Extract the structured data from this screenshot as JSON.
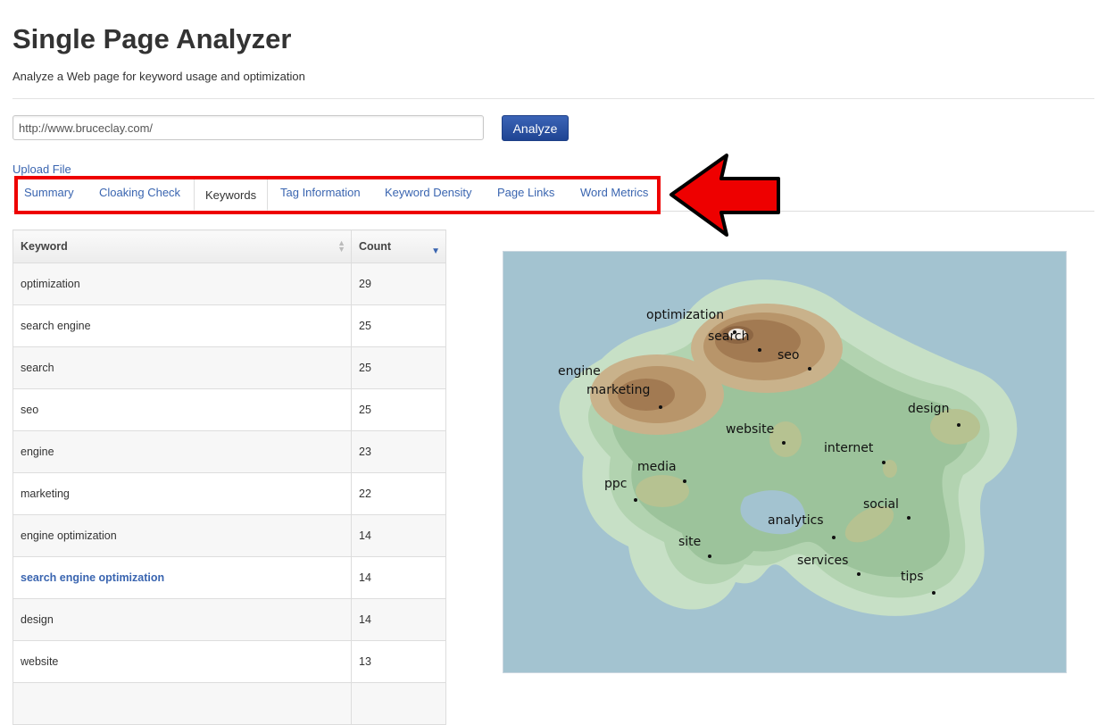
{
  "page": {
    "title": "Single Page Analyzer",
    "subtitle": "Analyze a Web page for keyword usage and optimization"
  },
  "form": {
    "url_value": "http://www.bruceclay.com/",
    "analyze_label": "Analyze",
    "upload_label": "Upload File"
  },
  "tabs": [
    {
      "label": "Summary"
    },
    {
      "label": "Cloaking Check"
    },
    {
      "label": "Keywords",
      "active": true
    },
    {
      "label": "Tag Information"
    },
    {
      "label": "Keyword Density"
    },
    {
      "label": "Page Links"
    },
    {
      "label": "Word Metrics"
    }
  ],
  "table": {
    "headers": {
      "keyword": "Keyword",
      "count": "Count"
    },
    "rows": [
      {
        "keyword": "optimization",
        "count": "29"
      },
      {
        "keyword": "search engine",
        "count": "25"
      },
      {
        "keyword": "search",
        "count": "25"
      },
      {
        "keyword": "seo",
        "count": "25"
      },
      {
        "keyword": "engine",
        "count": "23"
      },
      {
        "keyword": "marketing",
        "count": "22"
      },
      {
        "keyword": "engine optimization",
        "count": "14"
      },
      {
        "keyword": "search engine optimization",
        "count": "14",
        "highlight": true
      },
      {
        "keyword": "design",
        "count": "14"
      },
      {
        "keyword": "website",
        "count": "13"
      },
      {
        "keyword": "",
        "count": ""
      }
    ]
  },
  "keyword_map": {
    "labels": [
      "optimization",
      "search",
      "seo",
      "engine",
      "marketing",
      "website",
      "design",
      "internet",
      "media",
      "ppc",
      "social",
      "analytics",
      "site",
      "services",
      "tips"
    ]
  },
  "colors": {
    "link": "#3a65b0",
    "button": "#1f4493",
    "highlight": "#e00000",
    "water": "#a3c3d0"
  }
}
